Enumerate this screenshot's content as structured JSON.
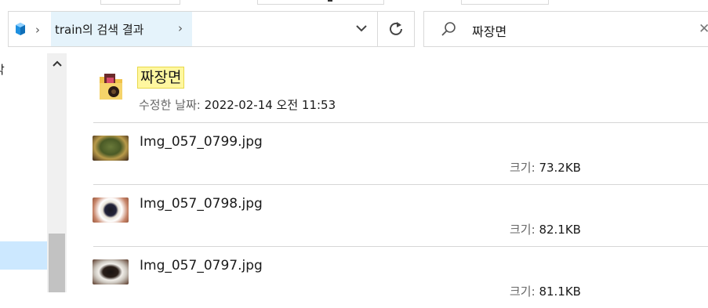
{
  "address_bar": {
    "breadcrumb_label": "train의 검색 결과"
  },
  "search": {
    "query": "짜장면"
  },
  "nav": {
    "partial_text": "악"
  },
  "folder": {
    "name": "짜장면",
    "modified_label": "수정한 날짜:",
    "modified_value": "2022-02-14 오전 11:53"
  },
  "files": [
    {
      "name": "Img_057_0799.jpg",
      "size_label": "크기:",
      "size_value": "73.2KB"
    },
    {
      "name": "Img_057_0798.jpg",
      "size_label": "크기:",
      "size_value": "82.1KB"
    },
    {
      "name": "Img_057_0797.jpg",
      "size_label": "크기:",
      "size_value": "81.1KB"
    }
  ],
  "colors": {
    "selection": "#cce8ff",
    "breadcrumb_hover": "#e5f3fb",
    "highlight": "#fff7a0"
  }
}
